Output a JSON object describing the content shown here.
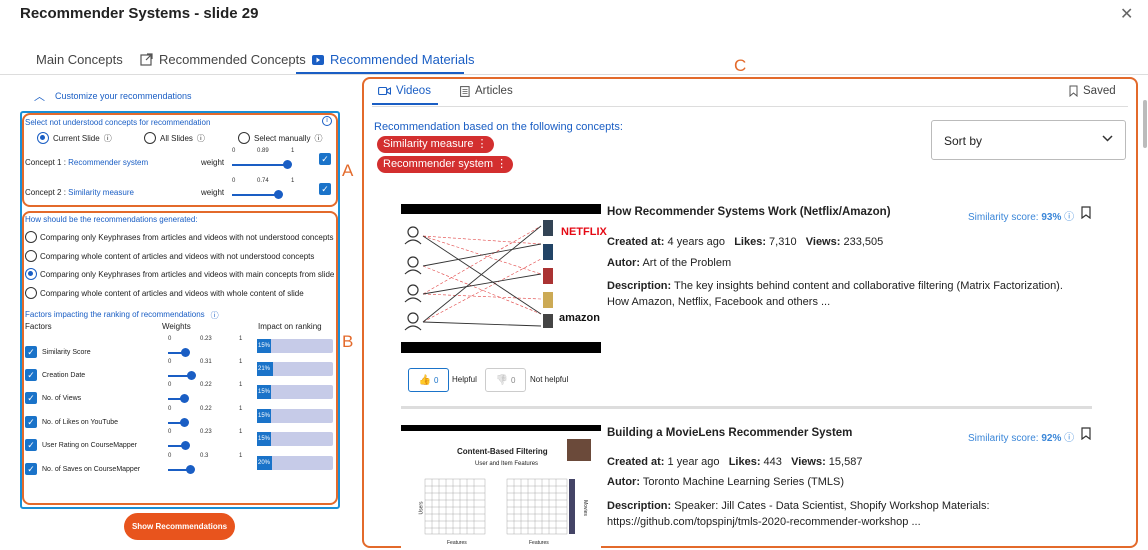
{
  "title": "Recommender Systems - slide 29",
  "tabs": [
    "Main Concepts",
    "Recommended Concepts",
    "Recommended Materials"
  ],
  "customize": "Customize your recommendations",
  "annot": {
    "a": "A",
    "b": "B",
    "c": "C"
  },
  "concepts_section": {
    "header": "Select not understood concepts for recommendation",
    "radios": [
      "Current Slide",
      "All Slides",
      "Select manually"
    ],
    "weight_label": "weight",
    "concepts": [
      {
        "prefix": "Concept 1 : ",
        "name": "Recommender system",
        "min": "0",
        "value": "0.89",
        "max": "1",
        "fraction": 0.89
      },
      {
        "prefix": "Concept 2 : ",
        "name": "Similarity measure",
        "min": "0",
        "value": "0.74",
        "max": "1",
        "fraction": 0.74
      }
    ]
  },
  "generation": {
    "header": "How should be the recommendations generated:",
    "options": [
      "Comparing only Keyphrases from articles and videos with not understood concepts",
      "Comparing whole content of articles and videos with not understood concepts",
      "Comparing only Keyphrases from articles and videos with main concepts from slide",
      "Comparing whole content of articles and videos with whole content of slide"
    ],
    "selected": 2
  },
  "factors": {
    "header": "Factors impacting the ranking of recommendations",
    "col_factors": "Factors",
    "col_weights": "Weights",
    "col_impact": "Impact on ranking",
    "rows": [
      {
        "name": "Similarity Score",
        "min": "0",
        "value": "0.23",
        "max": "1",
        "fraction": 0.23,
        "impact": "15%",
        "impact_frac": 0.15
      },
      {
        "name": "Creation Date",
        "min": "0",
        "value": "0.31",
        "max": "1",
        "fraction": 0.31,
        "impact": "21%",
        "impact_frac": 0.21
      },
      {
        "name": "No. of Views",
        "min": "0",
        "value": "0.22",
        "max": "1",
        "fraction": 0.22,
        "impact": "15%",
        "impact_frac": 0.15
      },
      {
        "name": "No. of Likes on YouTube",
        "min": "0",
        "value": "0.22",
        "max": "1",
        "fraction": 0.22,
        "impact": "15%",
        "impact_frac": 0.15
      },
      {
        "name": "User Rating on CourseMapper",
        "min": "0",
        "value": "0.23",
        "max": "1",
        "fraction": 0.23,
        "impact": "15%",
        "impact_frac": 0.15
      },
      {
        "name": "No. of Saves on CourseMapper",
        "min": "0",
        "value": "0.3",
        "max": "1",
        "fraction": 0.3,
        "impact": "20%",
        "impact_frac": 0.2
      }
    ]
  },
  "show_button": "Show Recommendations",
  "right": {
    "tab_videos": "Videos",
    "tab_articles": "Articles",
    "saved": "Saved",
    "based_on": "Recommendation based on the following concepts:",
    "pills": [
      "Similarity measure",
      "Recommender system"
    ],
    "sort_label": "Sort by",
    "videos": [
      {
        "title": "How Recommender Systems Work (Netflix/Amazon)",
        "similarity_label": "Similarity score:",
        "similarity": "93%",
        "created_label": "Created at:",
        "created": "4 years ago",
        "likes_label": "Likes:",
        "likes": "7,310",
        "views_label": "Views:",
        "views": "233,505",
        "author_label": "Autor:",
        "author": "Art of the Problem",
        "desc_label": "Description:",
        "desc": "The key insights behind content and collaborative filtering (Matrix Factorization). How Amazon, Netflix, Facebook and others ...",
        "thumb_netflix": "NETFLIX",
        "thumb_amazon": "amazon"
      },
      {
        "title": "Building a MovieLens Recommender System",
        "similarity_label": "Similarity score:",
        "similarity": "92%",
        "created_label": "Created at:",
        "created": "1 year ago",
        "likes_label": "Likes:",
        "likes": "443",
        "views_label": "Views:",
        "views": "15,587",
        "author_label": "Autor:",
        "author": "Toronto Machine Learning Series (TMLS)",
        "desc_label": "Description:",
        "desc": "Speaker: Jill Cates - Data Scientist, Shopify Workshop Materials: https://github.com/topspinj/tmls-2020-recommender-workshop ...",
        "thumb_title": "Content-Based Filtering",
        "thumb_sub": "User and Item Features",
        "thumb_users": "Users",
        "thumb_movies": "Movies",
        "thumb_features1": "Features",
        "thumb_features2": "Features"
      }
    ],
    "helpful": {
      "up_count": "0",
      "up_label": "Helpful",
      "down_count": "0",
      "down_label": "Not helpful"
    }
  }
}
